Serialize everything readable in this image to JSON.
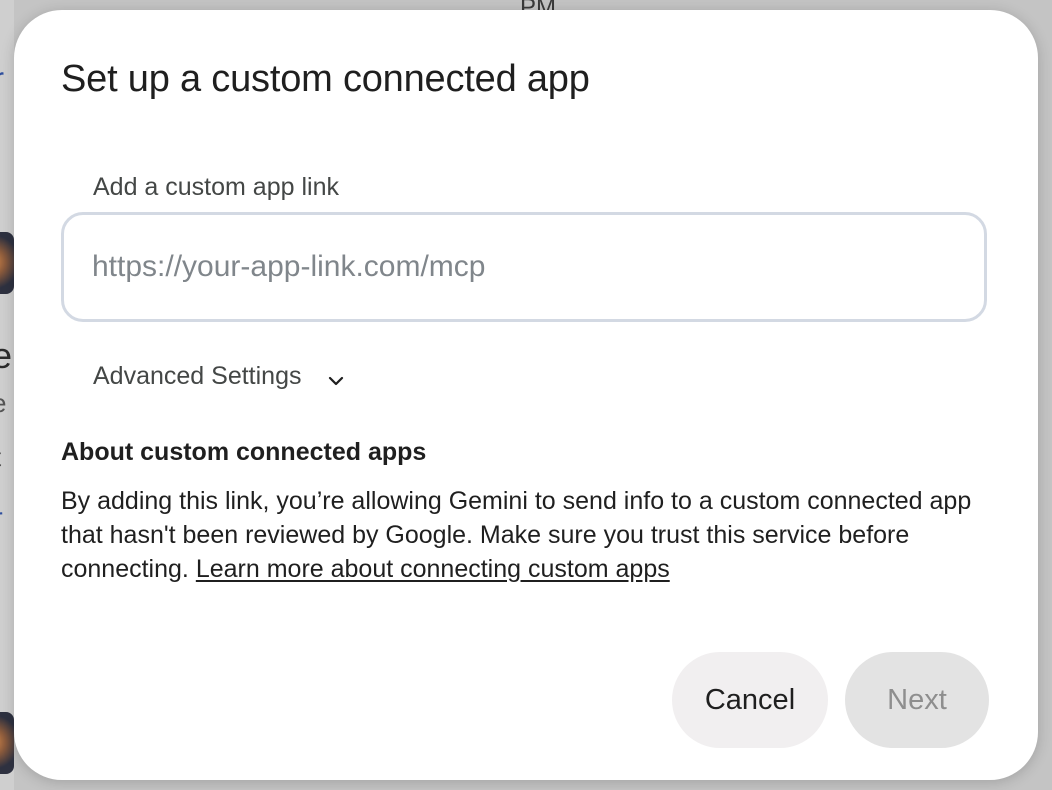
{
  "background": {
    "top_fragment": "PM",
    "left_fragments": [
      "r",
      "e",
      "e",
      "t",
      "r"
    ]
  },
  "dialog": {
    "title": "Set up a custom connected app",
    "link_field": {
      "label": "Add a custom app link",
      "placeholder": "https://your-app-link.com/mcp",
      "value": ""
    },
    "advanced_settings_label": "Advanced Settings",
    "advanced_icon": "chevron-down-icon",
    "about": {
      "heading": "About custom connected apps",
      "body": "By adding this link, you’re allowing Gemini to send info to a custom connected app that hasn't been reviewed by Google. Make sure you trust this service before connecting. ",
      "learn_more_link": "Learn more about connecting custom apps"
    },
    "buttons": {
      "cancel_label": "Cancel",
      "next_label": "Next",
      "next_enabled": false
    }
  },
  "colors": {
    "dialog_background": "#ffffff",
    "scrim": "#c4c4c4",
    "input_border": "#d3d9e3",
    "cancel_button": "#f1eff0",
    "next_button_disabled": "#e3e3e3",
    "link_color_background": "#2f4f9e"
  }
}
